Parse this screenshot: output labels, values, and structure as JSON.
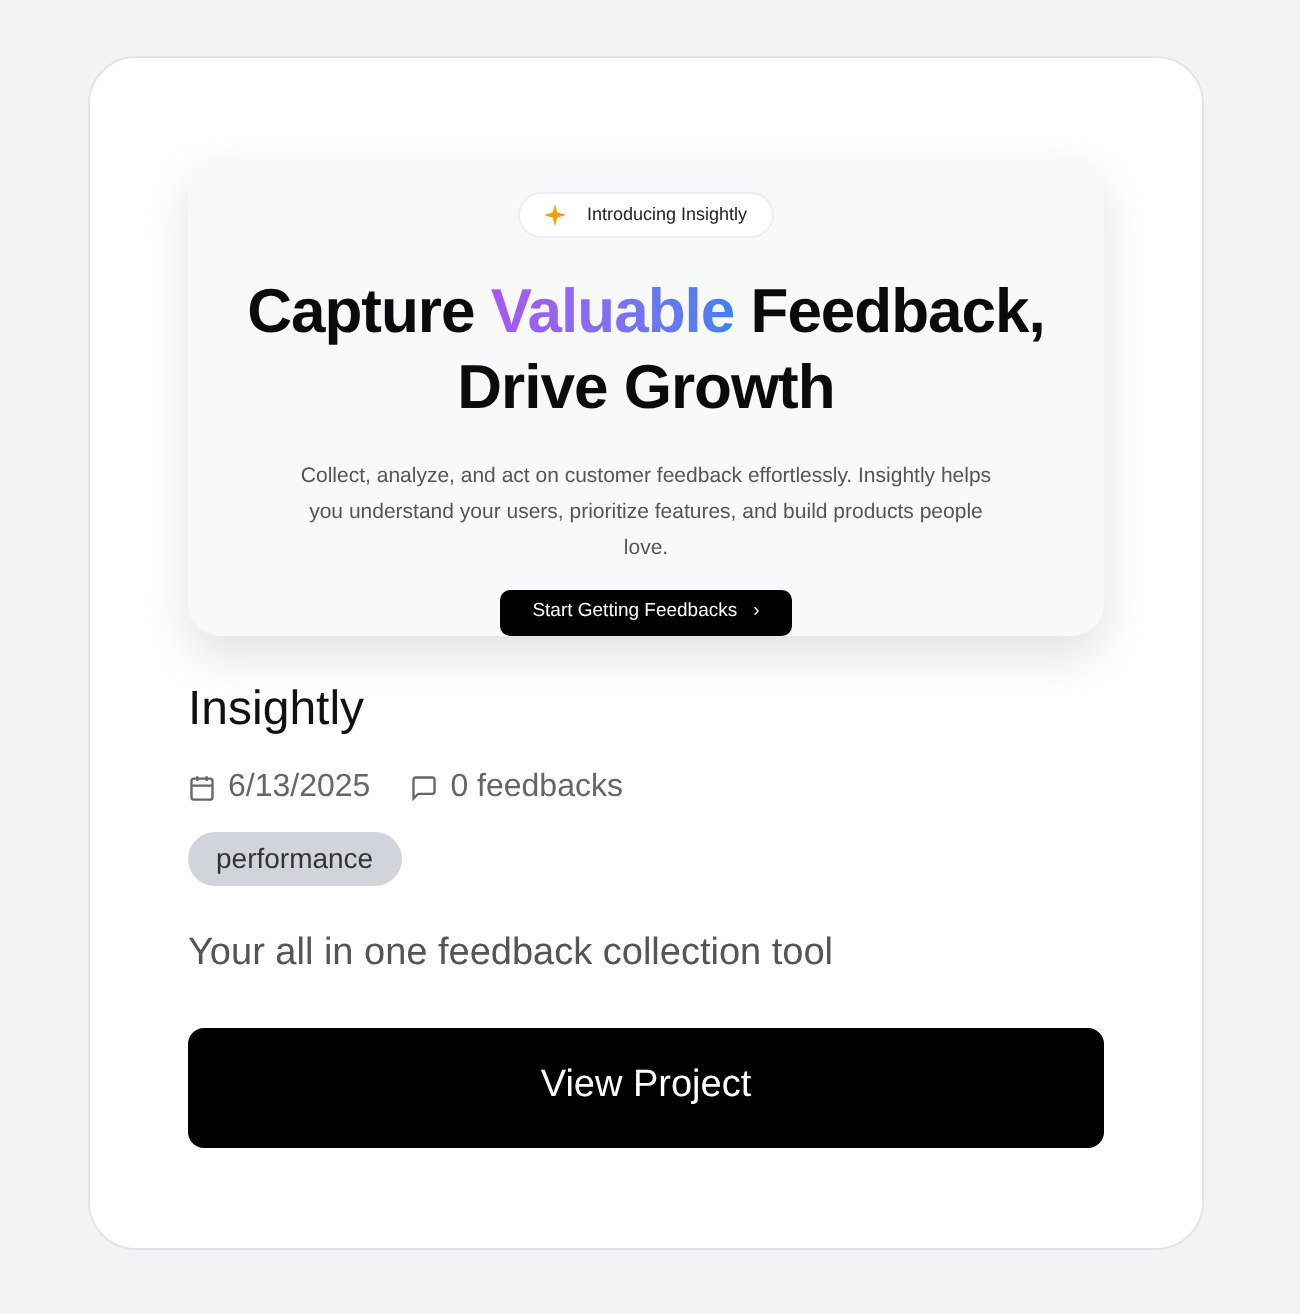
{
  "preview": {
    "badge": "Introducing Insightly",
    "headline": [
      {
        "kind": "plain",
        "text": "Capture "
      },
      {
        "kind": "gradient",
        "text": "Valuable"
      },
      {
        "kind": "plain",
        "text": " Feedback, Drive Growth"
      }
    ],
    "subtitle": "Collect, analyze, and act on customer feedback effortlessly. Insightly helps you understand your users, prioritize features, and build products people love.",
    "cta": "Start Getting Feedbacks",
    "cta_arrow": "›"
  },
  "project": {
    "name": "Insightly",
    "date": "6/13/2025",
    "feedbacks": "0 feedbacks",
    "tags": [
      "performance"
    ],
    "description": "Your all in one feedback collection tool",
    "button": "View Project"
  }
}
